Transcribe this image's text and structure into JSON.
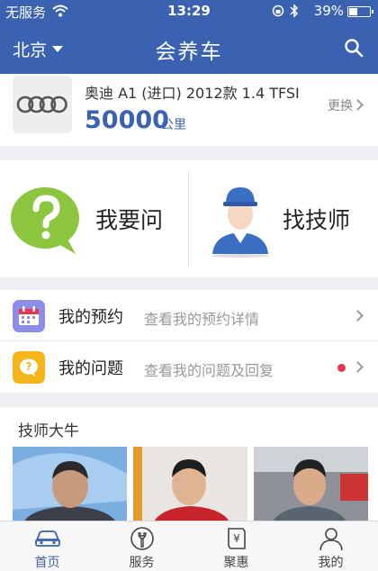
{
  "status_bar": {
    "carrier": "无服务",
    "time": "13:29",
    "battery": "39%",
    "battery_level": 0.39
  },
  "navbar": {
    "city": "北京",
    "title": "会养车",
    "search_icon": "search-icon"
  },
  "car": {
    "brand_logo": "audi-rings-logo",
    "model": "奥迪 A1 (进口) 2012款 1.4 TFSI",
    "mileage": "50000",
    "unit": "公里",
    "change_label": "更换"
  },
  "actions": [
    {
      "label": "我要问",
      "icon": "question-bubble-icon",
      "color": "#8cc63f"
    },
    {
      "label": "找技师",
      "icon": "mechanic-icon",
      "color": "#3a6fc4"
    }
  ],
  "list": [
    {
      "title": "我的预约",
      "sub": "查看我的预约详情",
      "icon": "calendar-icon",
      "color": "#8b8ee8"
    },
    {
      "title": "我的问题",
      "sub": "查看我的问题及回复",
      "icon": "question-chat-icon",
      "color": "#f5b51c",
      "has_dot": true
    }
  ],
  "experts": {
    "title": "技师大牛"
  },
  "tabs": [
    {
      "label": "首页",
      "icon": "car-icon",
      "active": true
    },
    {
      "label": "服务",
      "icon": "wrench-icon",
      "active": false
    },
    {
      "label": "聚惠",
      "icon": "coupon-icon",
      "active": false
    },
    {
      "label": "我的",
      "icon": "user-icon",
      "active": false
    }
  ],
  "colors": {
    "brand": "#3a62b0",
    "badge": "#e8344e"
  }
}
